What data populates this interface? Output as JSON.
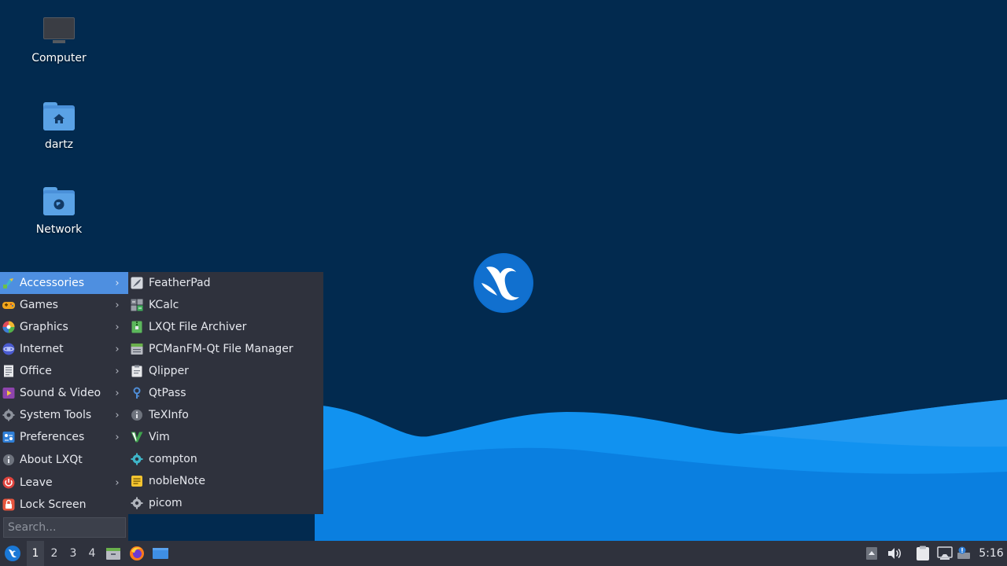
{
  "desktop": {
    "icons": [
      {
        "label": "Computer",
        "icon": "computer-icon"
      },
      {
        "label": "dartz",
        "icon": "home-folder-icon"
      },
      {
        "label": "Network",
        "icon": "network-folder-icon"
      }
    ]
  },
  "menu": {
    "items": [
      {
        "label": "Accessories",
        "icon": "accessories-icon",
        "submenu": true,
        "active": true
      },
      {
        "label": "Games",
        "icon": "games-icon",
        "submenu": true
      },
      {
        "label": "Graphics",
        "icon": "graphics-icon",
        "submenu": true
      },
      {
        "label": "Internet",
        "icon": "internet-icon",
        "submenu": true
      },
      {
        "label": "Office",
        "icon": "office-icon",
        "submenu": true
      },
      {
        "label": "Sound & Video",
        "icon": "sound-video-icon",
        "submenu": true
      },
      {
        "label": "System Tools",
        "icon": "system-tools-icon",
        "submenu": true
      },
      {
        "label": "Preferences",
        "icon": "preferences-icon",
        "submenu": true
      },
      {
        "label": "About LXQt",
        "icon": "info-icon",
        "submenu": false
      },
      {
        "label": "Leave",
        "icon": "power-icon",
        "submenu": true
      },
      {
        "label": "Lock Screen",
        "icon": "lock-icon",
        "submenu": false
      }
    ],
    "search_placeholder": "Search..."
  },
  "submenu": {
    "items": [
      {
        "label": "FeatherPad",
        "icon": "featherpad-icon"
      },
      {
        "label": "KCalc",
        "icon": "kcalc-icon"
      },
      {
        "label": "LXQt File Archiver",
        "icon": "archiver-icon"
      },
      {
        "label": "PCManFM-Qt File Manager",
        "icon": "file-manager-icon"
      },
      {
        "label": "Qlipper",
        "icon": "qlipper-icon"
      },
      {
        "label": "QtPass",
        "icon": "qtpass-icon"
      },
      {
        "label": "TeXInfo",
        "icon": "texinfo-icon"
      },
      {
        "label": "Vim",
        "icon": "vim-icon"
      },
      {
        "label": "compton",
        "icon": "compton-icon"
      },
      {
        "label": "nobleNote",
        "icon": "noblenote-icon"
      },
      {
        "label": "picom",
        "icon": "picom-icon"
      }
    ]
  },
  "taskbar": {
    "workspaces": [
      "1",
      "2",
      "3",
      "4"
    ],
    "active_workspace": "1",
    "clock": "5:16"
  },
  "colors": {
    "wallpaper_dark": "#022a4f",
    "wave_blue": "#0a82e6",
    "menu_bg": "#2f323d",
    "menu_highlight": "#4e8fe0"
  }
}
